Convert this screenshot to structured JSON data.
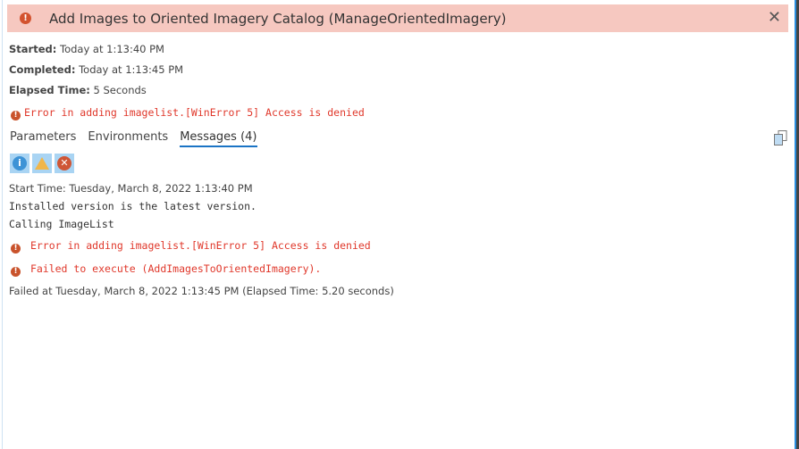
{
  "header": {
    "title": "Add Images to Oriented Imagery Catalog (ManageOrientedImagery)",
    "close": "✕"
  },
  "info": {
    "started_label": "Started:",
    "started": "Today at 1:13:40 PM",
    "completed_label": "Completed:",
    "completed": "Today at 1:13:45 PM",
    "elapsed_label": "Elapsed Time:",
    "elapsed": "5 Seconds",
    "error": "Error in adding imagelist.[WinError 5] Access is denied"
  },
  "tabs": [
    {
      "label": "Parameters"
    },
    {
      "label": "Environments"
    },
    {
      "label": "Messages (4)",
      "active": true
    }
  ],
  "messages": [
    "Start Time: Tuesday, March 8, 2022 1:13:40 PM",
    "Installed version is the latest version.",
    "Calling ImageList",
    "Error in adding imagelist.[WinError 5] Access is denied",
    "Failed to execute (AddImagesToOrientedImagery).",
    "Failed at Tuesday, March 8, 2022 1:13:45 PM (Elapsed Time: 5.20 seconds)"
  ]
}
